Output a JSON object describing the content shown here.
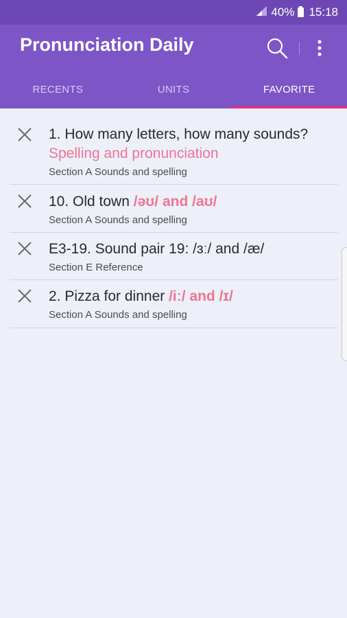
{
  "status": {
    "battery": "40%",
    "time": "15:18"
  },
  "app": {
    "title": "Pronunciation Daily"
  },
  "tabs": [
    {
      "label": "RECENTS"
    },
    {
      "label": "UNITS"
    },
    {
      "label": "FAVORITE",
      "active": true
    }
  ],
  "favorites": [
    {
      "text": "1. How many letters, how many sounds? ",
      "highlight": "Spelling and pronunciation",
      "section": "Section A Sounds and spelling"
    },
    {
      "text": "10. Old town ",
      "highlight": "/əʊ/ and /aʊ/",
      "section": "Section A Sounds and spelling"
    },
    {
      "text": "E3-19. Sound pair 19: /ɜː/ and /æ/",
      "highlight": "",
      "section": "Section E Reference"
    },
    {
      "text": "2. Pizza for dinner ",
      "highlight": "/iː/ and /ɪ/",
      "section": "Section A Sounds and spelling"
    }
  ],
  "colors": {
    "appbar": "#7d55c7",
    "statusbar": "#6d48b5",
    "accent": "#ec2d7a",
    "highlight": "#f07393",
    "background": "#edf0f9"
  },
  "icons": {
    "search": "search-icon",
    "more": "more-vert-icon",
    "remove": "close-icon"
  }
}
